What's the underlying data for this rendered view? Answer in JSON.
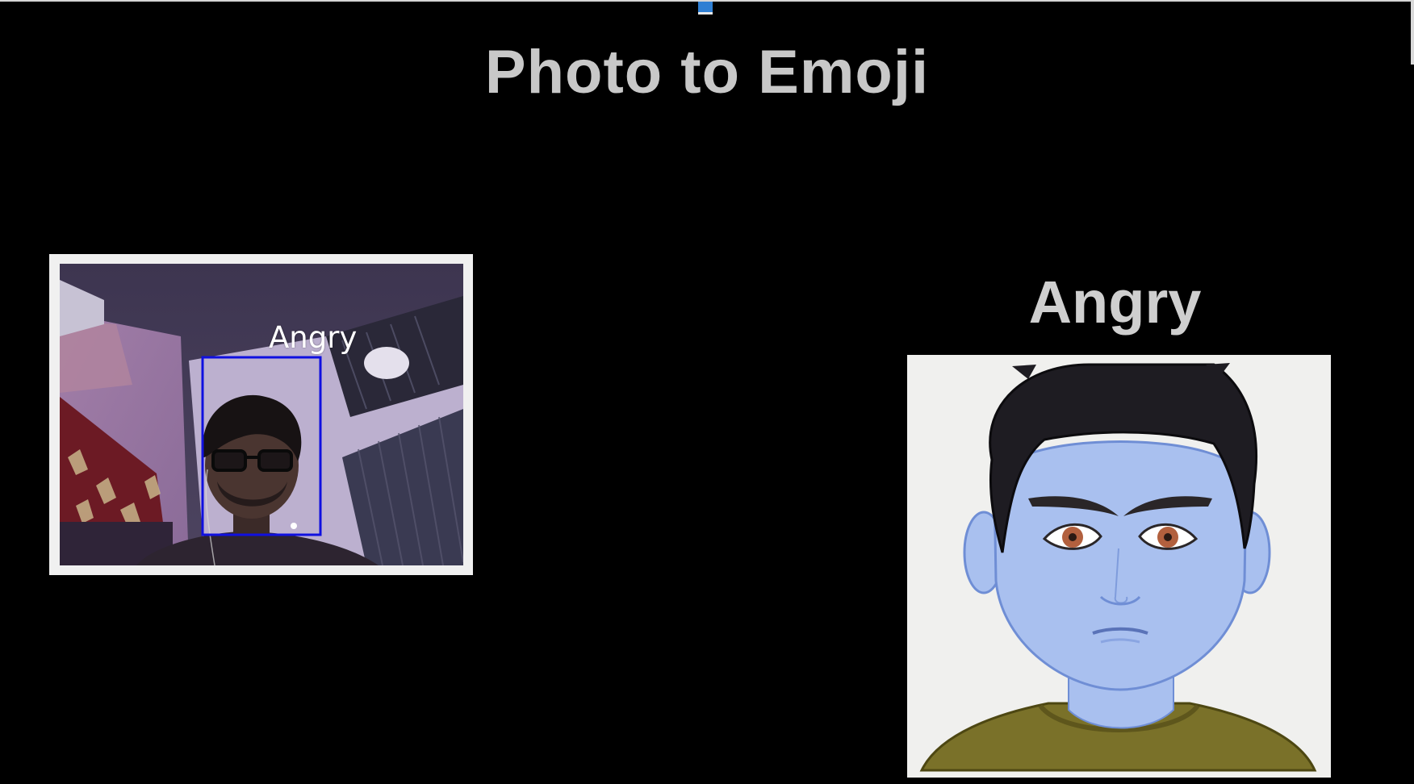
{
  "app": {
    "title": "Photo to Emoji"
  },
  "webcam": {
    "face_label": "Angry"
  },
  "result": {
    "emotion": "Angry",
    "emoji_icon": "angry-avatar"
  },
  "colors": {
    "background": "#000000",
    "title_text": "#c8c8c8",
    "face_box": "#1010e0",
    "avatar_skin": "#a9c0ef",
    "avatar_shirt": "#7a7129"
  }
}
